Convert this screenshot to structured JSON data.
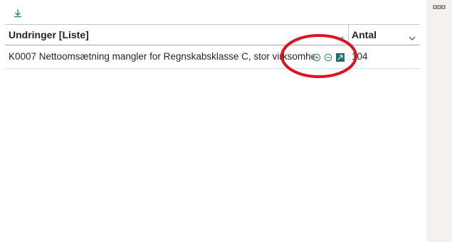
{
  "toolbar": {
    "download_icon": "download-icon",
    "more_icon": "more-options-icon"
  },
  "table": {
    "columns": [
      {
        "label": "Undringer [Liste]",
        "sort_icon": "chevron-down-icon"
      },
      {
        "label": "Antal",
        "sort_icon": "chevron-down-icon"
      }
    ],
    "rows": [
      {
        "label": "K0007 Nettoomsætning mangler for Regnskabsklasse C, stor virksomhed",
        "count": "104",
        "icons": [
          "expand-plus-icon",
          "collapse-minus-icon",
          "drill-box-icon"
        ]
      }
    ]
  },
  "colors": {
    "accent": "#2b7a78",
    "annotation": "#e0121b",
    "header_border": "#c8c6c4",
    "row_border": "#c8e0e0"
  }
}
